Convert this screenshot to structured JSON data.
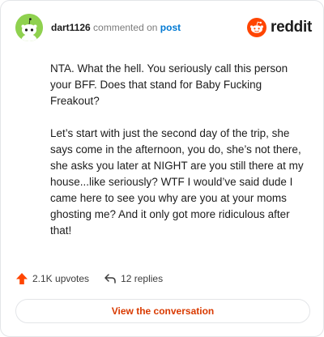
{
  "comment": {
    "username": "dart1126",
    "action_text": "commented on",
    "post_link": "post",
    "paragraphs": [
      "NTA. What the hell. You seriously call this person your BFF. Does that stand for Baby Fucking Freakout?",
      "Let’s start with just the second day of the trip, she says come in the afternoon, you do, she’s not there, she asks you later at NIGHT are you still there at my house...like seriously? WTF I would’ve said dude I came here to see you why are you at your moms ghosting me? And it only got more ridiculous after that!"
    ]
  },
  "brand": {
    "name": "reddit",
    "icon": "reddit-snoo-icon",
    "color": "#ff4500"
  },
  "stats": {
    "upvotes": "2.1K upvotes",
    "replies": "12 replies"
  },
  "cta": {
    "label": "View the conversation"
  },
  "colors": {
    "accent": "#ff4500",
    "link": "#0079d3",
    "cta_text": "#d93a00",
    "avatar_bg": "#8fd14f"
  }
}
